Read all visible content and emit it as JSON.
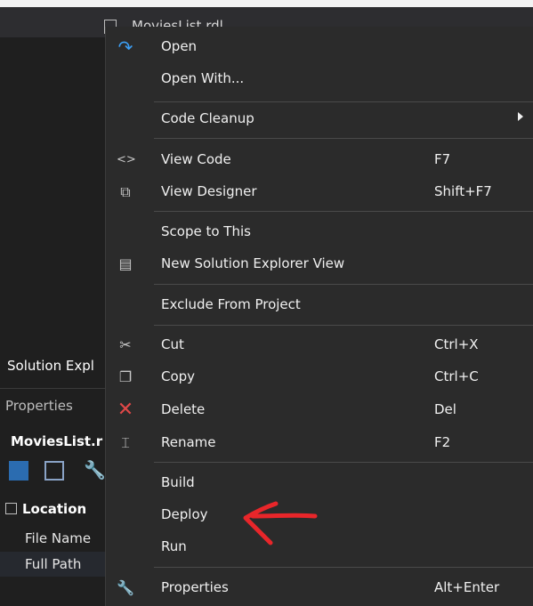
{
  "tab": {
    "filename": "MoviesList.rdl"
  },
  "left_panel": {
    "solution_label": "Solution Expl",
    "properties_label": "Properties",
    "file_label": "MoviesList.r",
    "location_label": "Location",
    "file_name_label": "File Name",
    "full_path_label": "Full Path"
  },
  "menu": {
    "open": {
      "label": "Open",
      "icon": "open-arrow-icon"
    },
    "open_with": {
      "label": "Open With..."
    },
    "code_cleanup": {
      "label": "Code Cleanup"
    },
    "view_code": {
      "label": "View Code",
      "shortcut": "F7",
      "icon": "code-brackets-icon"
    },
    "view_designer": {
      "label": "View Designer",
      "shortcut": "Shift+F7",
      "icon": "designer-icon"
    },
    "scope_to_this": {
      "label": "Scope to This"
    },
    "new_se_view": {
      "label": "New Solution Explorer View",
      "icon": "new-view-icon"
    },
    "exclude": {
      "label": "Exclude From Project"
    },
    "cut": {
      "label": "Cut",
      "shortcut": "Ctrl+X",
      "icon": "scissors-icon"
    },
    "copy": {
      "label": "Copy",
      "shortcut": "Ctrl+C",
      "icon": "copy-icon"
    },
    "delete": {
      "label": "Delete",
      "shortcut": "Del",
      "icon": "delete-x-icon"
    },
    "rename": {
      "label": "Rename",
      "shortcut": "F2",
      "icon": "rename-icon"
    },
    "build": {
      "label": "Build"
    },
    "deploy": {
      "label": "Deploy"
    },
    "run": {
      "label": "Run"
    },
    "properties": {
      "label": "Properties",
      "shortcut": "Alt+Enter",
      "icon": "wrench-icon"
    }
  },
  "colors": {
    "menu_bg": "#2b2b2b",
    "text": "#f0f0f0",
    "annotation_red": "#e8262a",
    "open_icon_blue": "#3c9ff5",
    "delete_icon_red": "#e04848"
  }
}
